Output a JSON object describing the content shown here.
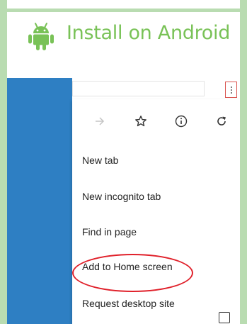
{
  "header": {
    "title": "Install on Android",
    "brand_color": "#79c257",
    "logo_icon": "android-icon"
  },
  "browser": {
    "toolbar": {
      "menu_icon": "more-vert-icon",
      "highlight_color": "#d9534f"
    },
    "background_panel_color": "#2e7fc3",
    "menu": {
      "icons": [
        "forward-arrow-icon",
        "star-icon",
        "info-icon",
        "refresh-icon"
      ],
      "items": [
        {
          "label": "New tab"
        },
        {
          "label": "New incognito tab"
        },
        {
          "label": "Find in page"
        },
        {
          "label": "Add to Home screen",
          "highlighted": true
        },
        {
          "label": "Request desktop site",
          "checkbox": false
        }
      ],
      "highlight_ring_color": "#e0202a"
    }
  }
}
